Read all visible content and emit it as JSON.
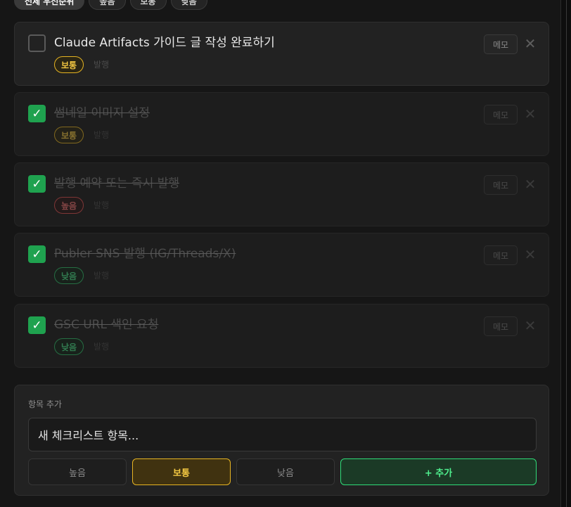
{
  "filters": [
    {
      "label": "전체 우선순위",
      "active": true
    },
    {
      "label": "높음",
      "active": false
    },
    {
      "label": "보통",
      "active": false
    },
    {
      "label": "낮음",
      "active": false
    }
  ],
  "todos": [
    {
      "title": "Claude Artifacts 가이드 글 작성 완료하기",
      "priority": "보통",
      "tag": "발행",
      "memo_label": "메모",
      "done": false
    },
    {
      "title": "썸네일 이미지 설정",
      "priority": "보통",
      "tag": "발행",
      "memo_label": "메모",
      "done": true
    },
    {
      "title": "발행 예약 또는 즉시 발행",
      "priority": "높음",
      "tag": "발행",
      "memo_label": "메모",
      "done": true
    },
    {
      "title": "Publer SNS 발행 (IG/Threads/X)",
      "priority": "낮음",
      "tag": "발행",
      "memo_label": "메모",
      "done": true
    },
    {
      "title": "GSC URL 색인 요청",
      "priority": "낮음",
      "tag": "발행",
      "memo_label": "메모",
      "done": true
    }
  ],
  "add": {
    "label": "항목 추가",
    "input_value": "새 체크리스트 항목...",
    "priority_options": [
      "높음",
      "보통",
      "낮음"
    ],
    "selected_priority": "보통",
    "add_button": "+ 추가"
  },
  "colors": {
    "accent_green": "#2fdc78",
    "priority_mid": "#e6b422",
    "priority_high": "#e05050",
    "priority_low": "#2fbf6a"
  },
  "icons": {
    "checkbox_checked": "check-icon",
    "delete": "close-icon"
  }
}
